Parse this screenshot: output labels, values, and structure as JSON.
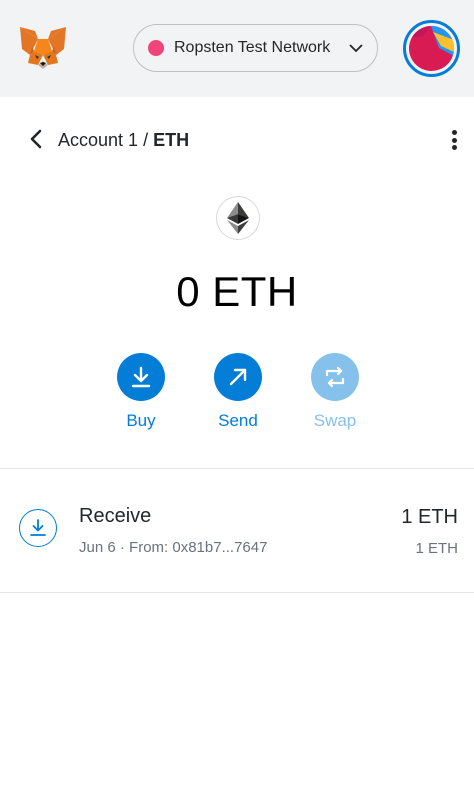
{
  "header": {
    "network": {
      "name": "Ropsten Test Network",
      "dot_color": "#f0447a"
    }
  },
  "account": {
    "name": "Account 1",
    "separator": " / ",
    "symbol": "ETH"
  },
  "balance": {
    "text": "0 ETH"
  },
  "actions": [
    {
      "label": "Buy",
      "icon": "download-icon",
      "enabled": true
    },
    {
      "label": "Send",
      "icon": "arrow-up-right-icon",
      "enabled": true
    },
    {
      "label": "Swap",
      "icon": "swap-icon",
      "enabled": false
    }
  ],
  "transactions": [
    {
      "title": "Receive",
      "date": "Jun 6",
      "bullet": " · ",
      "from": "From: 0x81b7...7647",
      "amount": "1 ETH",
      "fiat": "1 ETH",
      "icon": "receive-icon"
    }
  ],
  "colors": {
    "accent": "#037dd6",
    "accent_disabled": "#86c1ec",
    "topbar": "#f2f3f4"
  }
}
